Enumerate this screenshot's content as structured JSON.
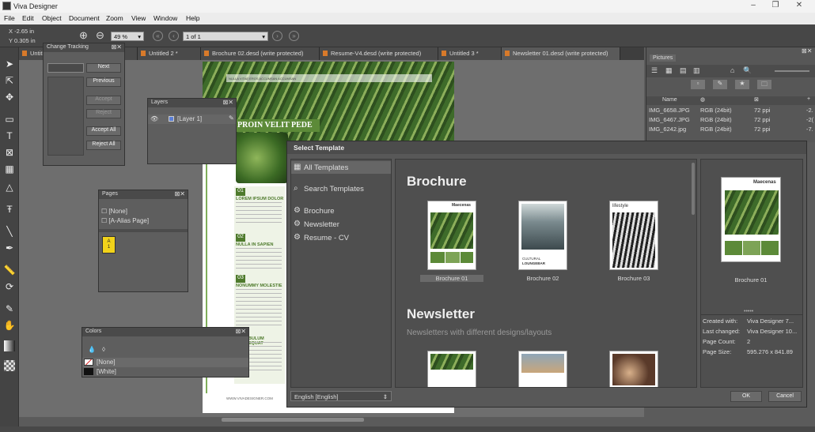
{
  "app": {
    "title": "Viva Designer"
  },
  "menu": [
    "File",
    "Edit",
    "Object",
    "Document",
    "Zoom",
    "View",
    "Window",
    "Help"
  ],
  "coords": {
    "x": "X   -2.65 in",
    "y": "Y   0.305 in"
  },
  "zoom": {
    "value": "49 %"
  },
  "page_select": {
    "value": "1 of 1"
  },
  "tabs": [
    "Untitled 1",
    "Untitled 2 *",
    "Brochure 02.desd (write protected)",
    "Resume-V4.desd (write protected)",
    "Untitled 3 *",
    "Newsletter 01.desd (write protected)"
  ],
  "change_tracking": {
    "title": "Change Tracking",
    "next": "Next",
    "previous": "Previous",
    "accept": "Accept",
    "reject": "Reject",
    "accept_all": "Accept All",
    "reject_all": "Reject All"
  },
  "layers": {
    "title": "Layers",
    "item": "[Layer 1]"
  },
  "pages": {
    "title": "Pages",
    "items": [
      "[None]",
      "[A-Alias Page]"
    ],
    "thumb_label": "A\n1"
  },
  "colors": {
    "title": "Colors",
    "items": [
      "[None]",
      "[White]"
    ]
  },
  "page_content": {
    "banner": "PROIN VELIT PEDE",
    "headline_small": "NULLA VITAE EROS ACCUMSAN ACCUMSAN",
    "num1": "01",
    "sec1": "LOREM IPSUM DOLOR",
    "num2": "02",
    "sec2": "NULLA IN SAPIEN",
    "num3": "03",
    "sec3": "NONUMMY MOLESTIE",
    "sec4": "VESTIBULUM CONSEQUAT",
    "footer": "WWW.VIVADESIGNER.COM"
  },
  "pictures": {
    "title": "Pictures",
    "columns": [
      "Name",
      "",
      "",
      ""
    ],
    "rows": [
      {
        "name": "IMG_6658.JPG",
        "mode": "RGB (24bit)",
        "res": "72 ppi",
        "val": "-2."
      },
      {
        "name": "IMG_6467.JPG",
        "mode": "RGB (24bit)",
        "res": "72 ppi",
        "val": "-2("
      },
      {
        "name": "IMG_6242.jpg",
        "mode": "RGB (24bit)",
        "res": "72 ppi",
        "val": "-7."
      }
    ]
  },
  "dialog": {
    "title": "Select Template",
    "nav": {
      "all": "All Templates",
      "search": "Search Templates",
      "cats": [
        "Brochure",
        "Newsletter",
        "Resume - CV"
      ]
    },
    "sections": [
      {
        "title": "Brochure",
        "items": [
          "Brochure 01",
          "Brochure 02",
          "Brochure 03"
        ]
      },
      {
        "title": "Newsletter",
        "subtitle": "Newsletters with different designs/layouts"
      }
    ],
    "thumb_text": {
      "maecenas": "Maecenas",
      "cultural": "CULTURAL",
      "loungebar": "LOUNGEBAR",
      "lifestyle": "lifestyle"
    },
    "preview": {
      "label": "Brochure 01",
      "created_k": "Created with:",
      "created_v": "Viva Designer 7...",
      "changed_k": "Last changed:",
      "changed_v": "Viva Designer 10...",
      "count_k": "Page Count:",
      "count_v": "2",
      "size_k": "Page Size:",
      "size_v": "595.276 x 841.89"
    },
    "language": "English [English]",
    "ok": "OK",
    "cancel": "Cancel"
  }
}
